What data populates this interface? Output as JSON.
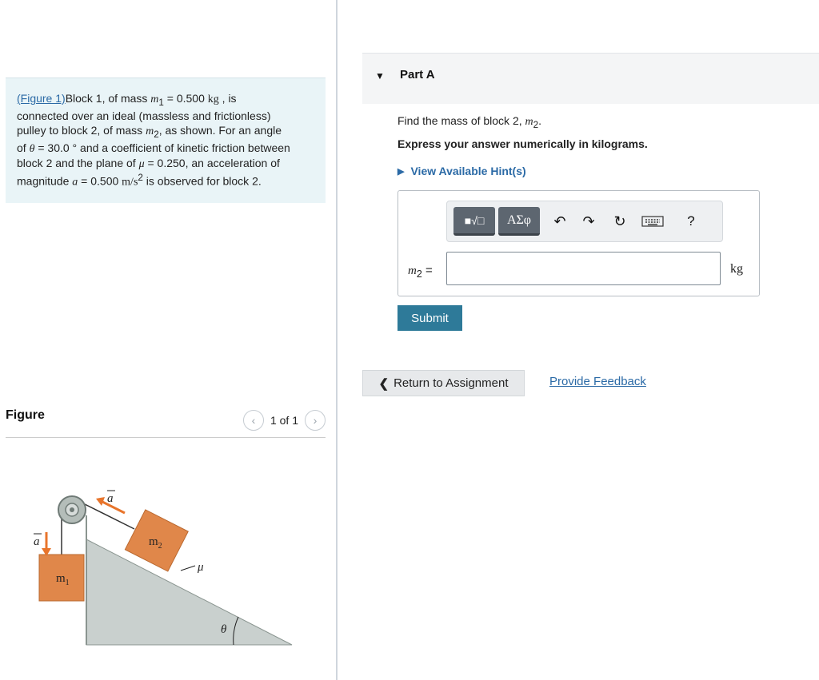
{
  "problem": {
    "figure_link": "(Figure 1)",
    "line1_a": "Block 1, of mass ",
    "line1_sym": "m",
    "line1_sub": "1",
    "line1_b": " = 0.500 ",
    "line1_unit": "kg",
    "line1_c": " , is",
    "line2": "connected over an ideal (massless and frictionless)",
    "line3_a": "pulley to block 2, of mass ",
    "line3_sym": "m",
    "line3_sub": "2",
    "line3_b": ", as shown. For an angle",
    "line4_a": "of ",
    "line4_sym": "θ",
    "line4_b": " = 30.0 ° and a coefficient of kinetic friction between",
    "line5_a": "block 2 and the plane of ",
    "line5_sym": "μ",
    "line5_b": " = 0.250, an acceleration of",
    "line6_a": "magnitude ",
    "line6_sym": "a",
    "line6_b": " = 0.500 ",
    "line6_unit": "m/s",
    "line6_sup": "2",
    "line6_c": " is observed for block 2."
  },
  "figure": {
    "title": "Figure",
    "page": "1 of 1",
    "prev_icon": "chevron-left-icon",
    "next_icon": "chevron-right-icon",
    "labels": {
      "a": "a",
      "m1": "m",
      "m1_sub": "1",
      "m2": "m",
      "m2_sub": "2",
      "mu": "μ",
      "theta": "θ"
    }
  },
  "part": {
    "title": "Part A",
    "question_a": "Find the mass of block 2, ",
    "question_sym": "m",
    "question_sub": "2",
    "question_b": ".",
    "instruction": "Express your answer numerically in kilograms.",
    "hint": "View Available Hint(s)"
  },
  "answer": {
    "label_sym": "m",
    "label_sub": "2",
    "label_eq": " =",
    "value": "",
    "unit": "kg",
    "toolbar": {
      "templates_label": "■√□",
      "greek_label": "ΑΣφ",
      "help": "?"
    }
  },
  "submit": "Submit",
  "return": "Return to Assignment",
  "feedback": "Provide Feedback",
  "colors": {
    "link": "#2b6aa6",
    "submit": "#2e7a99",
    "problem_bg": "#e9f4f7",
    "arrow": "#e8752c",
    "block": "#e0874a",
    "incline": "#c9d0ce"
  }
}
